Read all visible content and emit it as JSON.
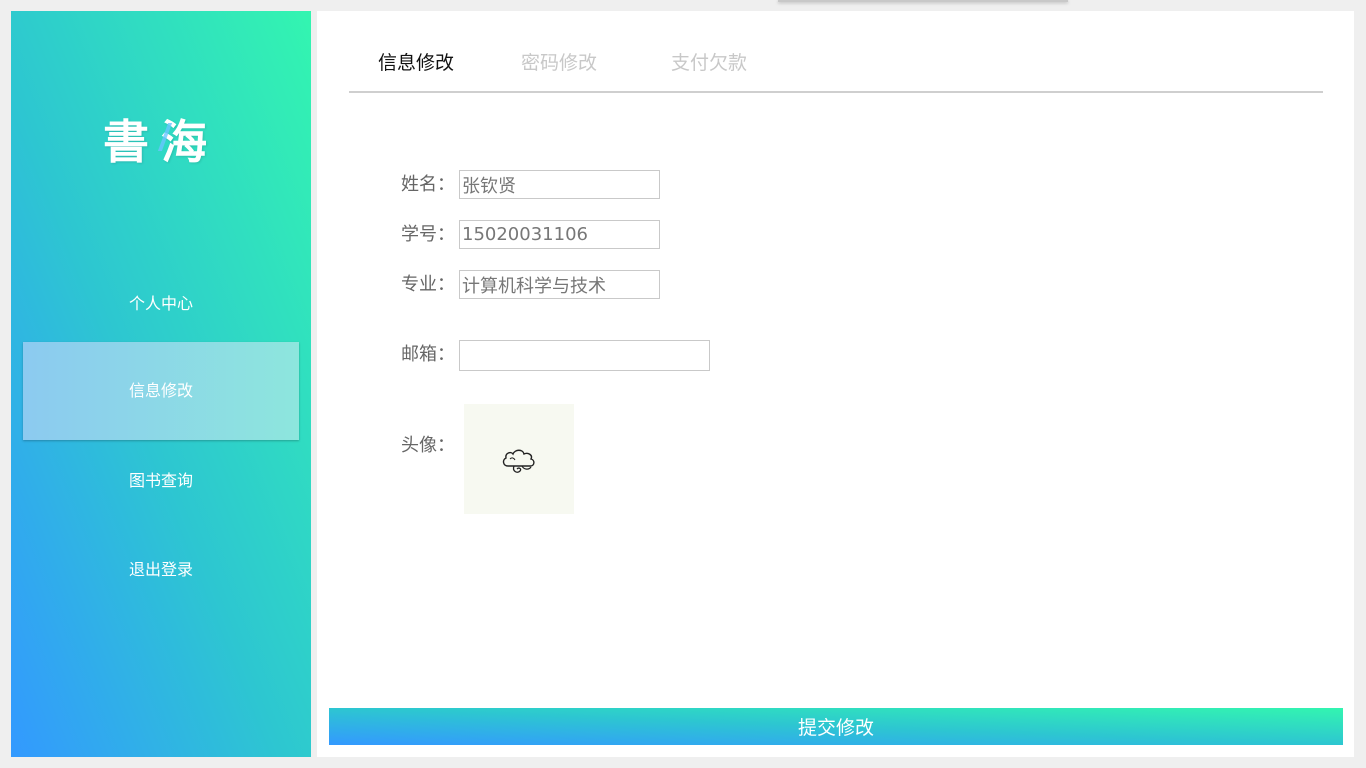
{
  "sidebar": {
    "logo_part1": "書",
    "logo_part2": "海",
    "items": [
      {
        "label": "个人中心"
      },
      {
        "label": "信息修改"
      },
      {
        "label": "图书查询"
      },
      {
        "label": "退出登录"
      }
    ]
  },
  "tabs": [
    {
      "label": "信息修改"
    },
    {
      "label": "密码修改"
    },
    {
      "label": "支付欠款"
    }
  ],
  "form": {
    "name_label": "姓名：",
    "name_value": "张钦贤",
    "id_label": "学号：",
    "id_value": "15020031106",
    "major_label": "专业：",
    "major_value": "计算机科学与技术",
    "email_label": "邮箱：",
    "email_value": "",
    "avatar_label": "头像：",
    "avatar_icon": "cloud-icon"
  },
  "submit_label": "提交修改",
  "colors": {
    "gradient_start": "#3399ff",
    "gradient_end": "#33f5b0",
    "active_tab": "#111111",
    "inactive_tab": "#c8c8c8"
  }
}
